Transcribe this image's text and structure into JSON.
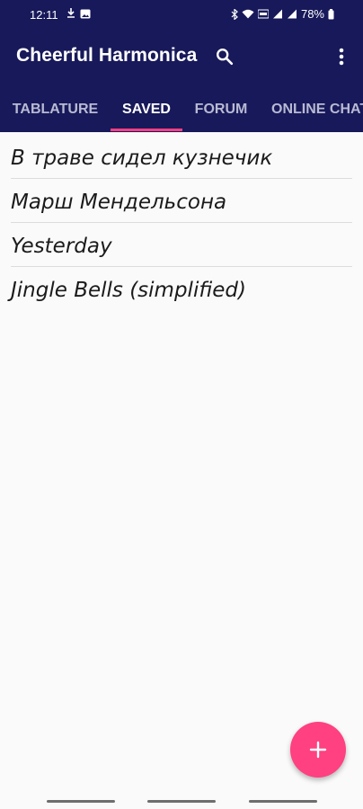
{
  "status_bar": {
    "time": "12:11",
    "battery": "78%"
  },
  "app": {
    "title": "Cheerful Harmonica",
    "primary_color": "#18195a",
    "accent_color": "#ff4081"
  },
  "toolbar": {
    "search_icon": "search-icon",
    "more_icon": "more-vert-icon"
  },
  "tabs": [
    {
      "label": "TABLATURE",
      "active": false
    },
    {
      "label": "SAVED",
      "active": true
    },
    {
      "label": "FORUM",
      "active": false
    },
    {
      "label": "ONLINE CHAT",
      "active": false
    }
  ],
  "saved_items": [
    {
      "title": "В траве сидел кузнечик"
    },
    {
      "title": "Марш Мендельсона"
    },
    {
      "title": "Yesterday"
    },
    {
      "title": "Jingle Bells (simplified)"
    }
  ],
  "fab": {
    "icon": "plus-icon"
  }
}
